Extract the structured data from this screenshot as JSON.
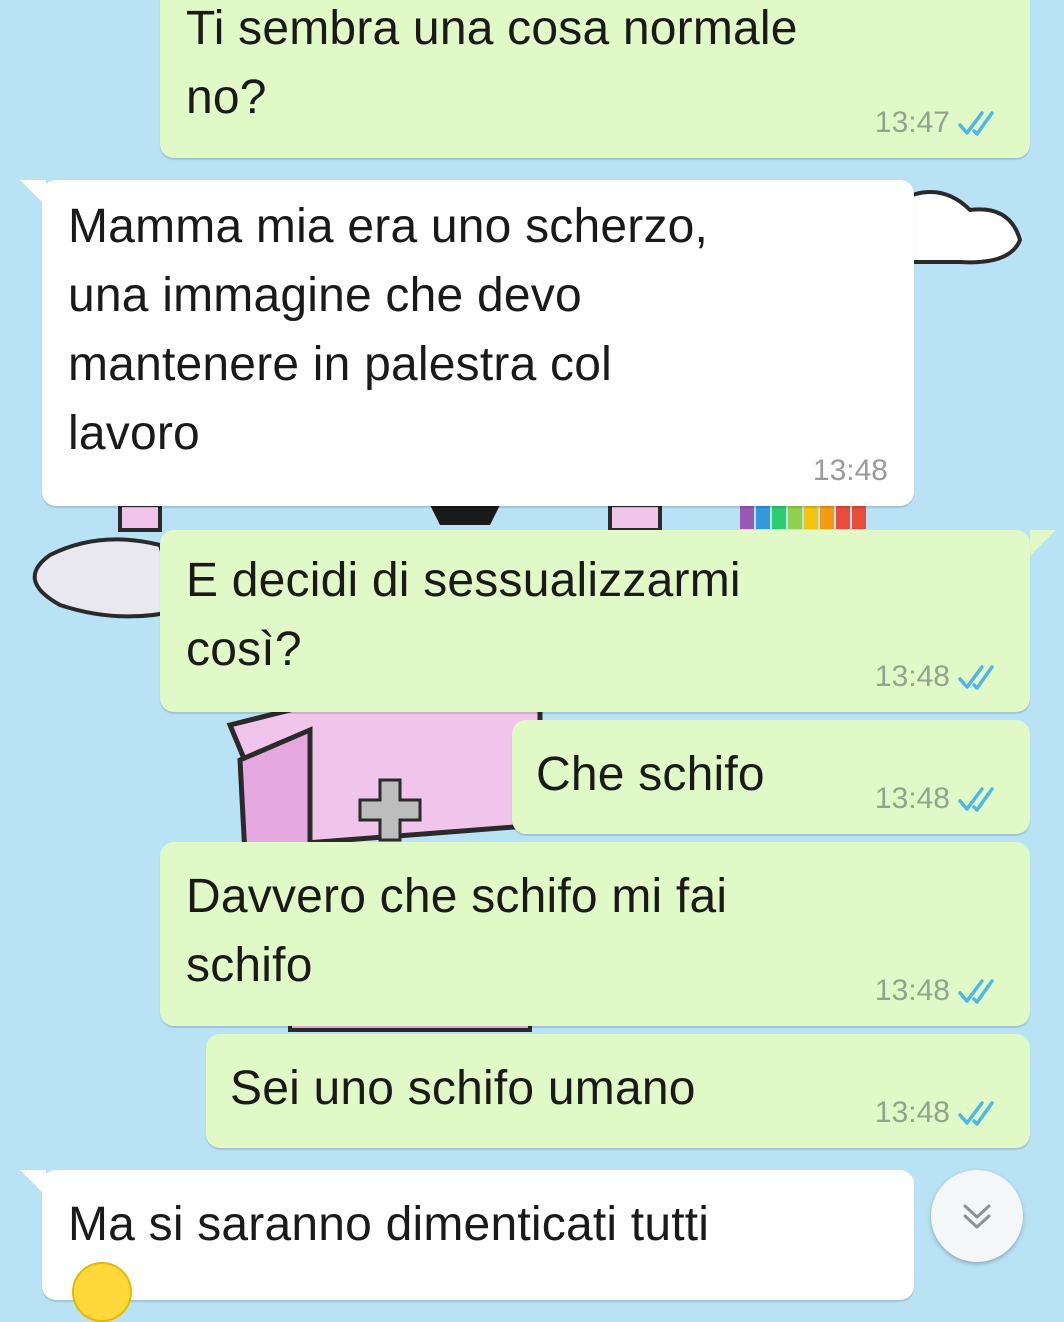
{
  "chat": {
    "messages": [
      {
        "dir": "out",
        "text": "Ti sembra una cosa normale\nno?",
        "time": "13:47",
        "read": true
      },
      {
        "dir": "in",
        "text": "Mamma mia era uno scherzo,\nuna immagine che devo\nmantenere in palestra col\nlavoro",
        "time": "13:48"
      },
      {
        "dir": "out",
        "text": "E decidi di sessualizzarmi\ncosì?",
        "time": "13:48",
        "read": true
      },
      {
        "dir": "out",
        "text": "Che schifo",
        "time": "13:48",
        "read": true
      },
      {
        "dir": "out",
        "text": "Davvero che schifo mi fai\nschifo",
        "time": "13:48",
        "read": true
      },
      {
        "dir": "out",
        "text": "Sei uno schifo umano",
        "time": "13:48",
        "read": true
      },
      {
        "dir": "in",
        "text": "Ma si saranno dimenticati tutti",
        "time": "",
        "emoji": "slightly-smiling-face"
      }
    ]
  },
  "icons": {
    "read_receipt": "double-check-icon",
    "scroll_down": "chevron-double-down-icon"
  },
  "colors": {
    "background": "#b9e2f5",
    "outgoing_bubble": "#e1f9c6",
    "incoming_bubble": "#ffffff",
    "read_tick": "#4fb6ec"
  }
}
